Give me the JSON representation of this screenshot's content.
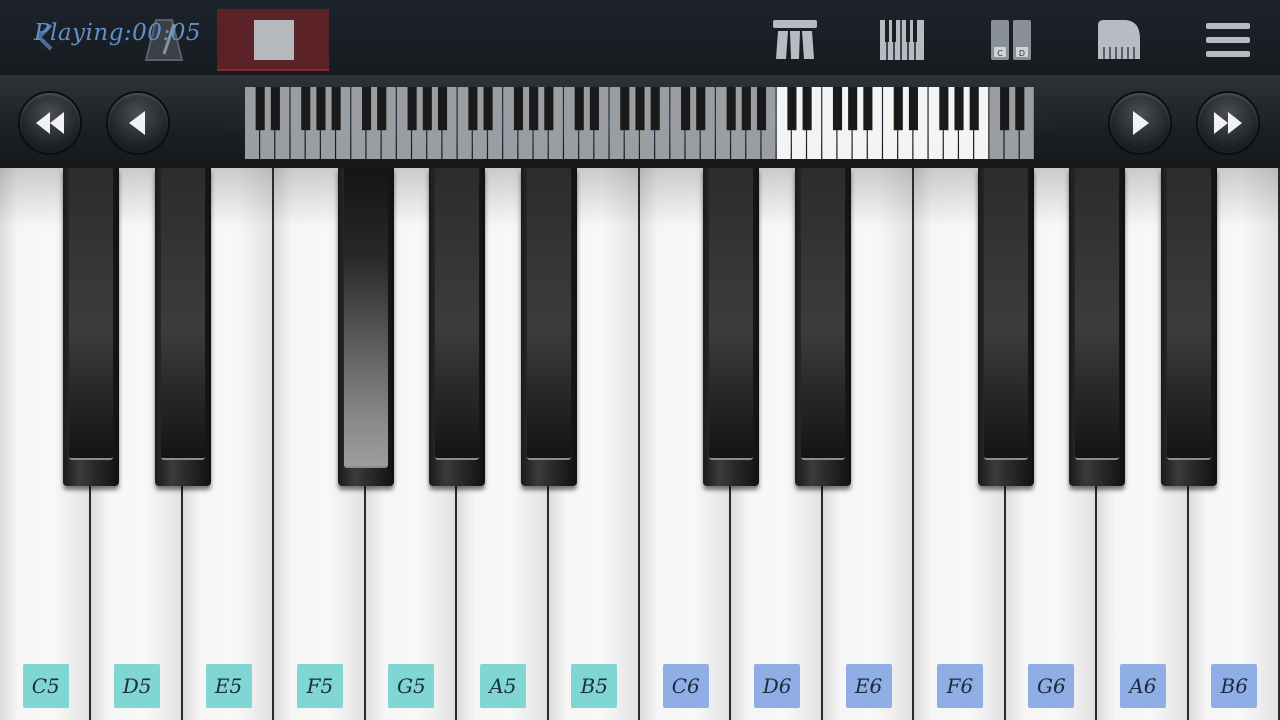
{
  "topbar": {
    "status": "Playing:00:05",
    "icons": [
      "back-arrow-icon",
      "metronome-icon",
      "stop-icon",
      "sustain-pedal-icon",
      "keyboard-icon",
      "chord-icon",
      "grand-piano-icon",
      "menu-icon"
    ]
  },
  "navigation": {
    "buttons": [
      "fast-rewind-icon",
      "previous-icon",
      "next-icon",
      "fast-forward-icon"
    ]
  },
  "keyboard": {
    "white_keys": [
      {
        "note": "C5",
        "octave": 5
      },
      {
        "note": "D5",
        "octave": 5
      },
      {
        "note": "E5",
        "octave": 5
      },
      {
        "note": "F5",
        "octave": 5
      },
      {
        "note": "G5",
        "octave": 5
      },
      {
        "note": "A5",
        "octave": 5
      },
      {
        "note": "B5",
        "octave": 5
      },
      {
        "note": "C6",
        "octave": 6
      },
      {
        "note": "D6",
        "octave": 6
      },
      {
        "note": "E6",
        "octave": 6
      },
      {
        "note": "F6",
        "octave": 6
      },
      {
        "note": "G6",
        "octave": 6
      },
      {
        "note": "A6",
        "octave": 6
      },
      {
        "note": "B6",
        "octave": 6
      }
    ],
    "pressed_black_key": "F#5"
  },
  "colors": {
    "status_text": "#5f90cc",
    "octave5_label": "#7fd6d2",
    "octave6_label": "#8faee6",
    "stop_button": "#5a2226"
  }
}
